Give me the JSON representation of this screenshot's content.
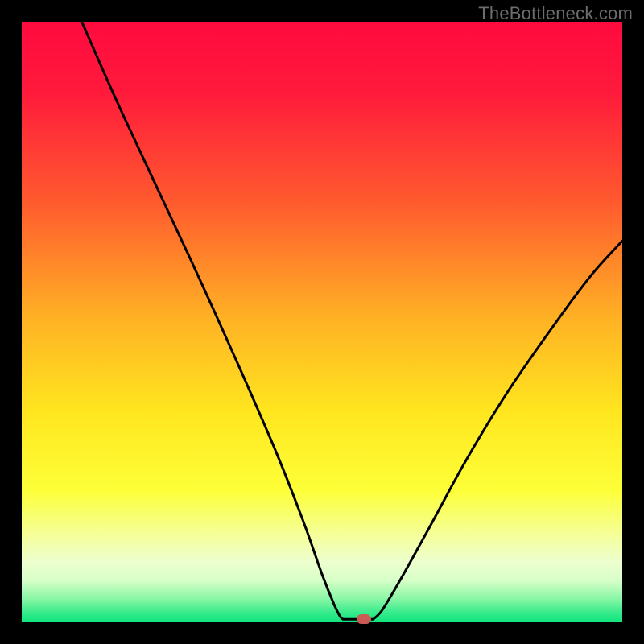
{
  "watermark": "TheBottleneck.com",
  "chart_data": {
    "type": "line",
    "title": "",
    "xlabel": "",
    "ylabel": "",
    "xlim": [
      0,
      100
    ],
    "ylim": [
      0,
      100
    ],
    "gradient_stops": [
      {
        "offset": 0,
        "color": "#ff0a3f"
      },
      {
        "offset": 12,
        "color": "#ff1b3b"
      },
      {
        "offset": 30,
        "color": "#ff5a2e"
      },
      {
        "offset": 50,
        "color": "#ffb424"
      },
      {
        "offset": 65,
        "color": "#ffe61f"
      },
      {
        "offset": 78,
        "color": "#fdff38"
      },
      {
        "offset": 86,
        "color": "#f4ffa0"
      },
      {
        "offset": 90,
        "color": "#edffcf"
      },
      {
        "offset": 93,
        "color": "#d8ffc8"
      },
      {
        "offset": 96,
        "color": "#8bf7a6"
      },
      {
        "offset": 98.5,
        "color": "#33ea8a"
      },
      {
        "offset": 100,
        "color": "#0fe57e"
      }
    ],
    "series": [
      {
        "name": "bottleneck-curve-left",
        "x": [
          10.0,
          15.5,
          22.0,
          29.0,
          36.0,
          42.5,
          47.0,
          50.0,
          52.0,
          53.0,
          53.5
        ],
        "y": [
          100.0,
          87.5,
          73.5,
          58.5,
          43.0,
          28.0,
          16.5,
          8.0,
          3.0,
          1.0,
          0.5
        ]
      },
      {
        "name": "bottleneck-curve-flat",
        "x": [
          53.5,
          56.5,
          58.5
        ],
        "y": [
          0.5,
          0.5,
          0.5
        ]
      },
      {
        "name": "bottleneck-curve-right",
        "x": [
          58.5,
          60.0,
          63.0,
          68.0,
          74.0,
          81.0,
          89.0,
          95.0,
          100.0
        ],
        "y": [
          0.5,
          2.0,
          7.0,
          16.0,
          27.0,
          38.5,
          50.0,
          58.0,
          63.5
        ]
      }
    ],
    "marker": {
      "x": 57,
      "y": 0.5,
      "color": "#cb5a55"
    },
    "annotations": []
  }
}
